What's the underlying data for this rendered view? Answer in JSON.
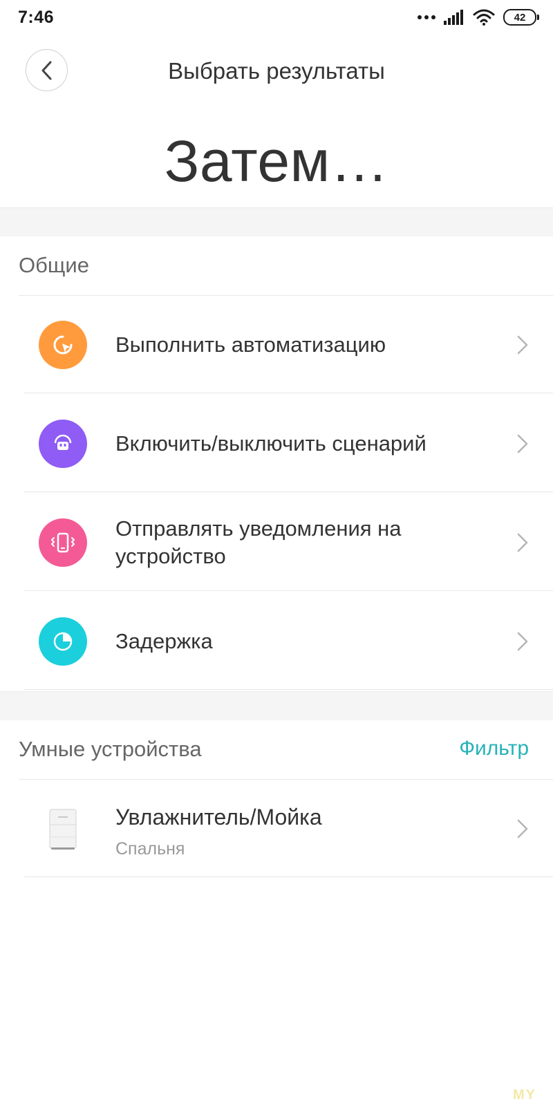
{
  "status_bar": {
    "time": "7:46",
    "battery": "42",
    "icons": [
      "more-dots-icon",
      "signal-icon",
      "wifi-icon",
      "battery-icon"
    ]
  },
  "header": {
    "title": "Выбрать результаты"
  },
  "page_title": "Затем…",
  "general_section": {
    "title": "Общие",
    "items": [
      {
        "label": "Выполнить автоматизацию",
        "icon": "automation-icon",
        "color": "#ff9b3d"
      },
      {
        "label": "Включить/выключить сценарий",
        "icon": "scenario-icon",
        "color": "#8f5cf5"
      },
      {
        "label": "Отправлять уведомления на устройство",
        "icon": "notification-icon",
        "color": "#f45b96"
      },
      {
        "label": "Задержка",
        "icon": "delay-icon",
        "color": "#1ccfdc"
      }
    ]
  },
  "devices_section": {
    "title": "Умные устройства",
    "filter_label": "Фильтр",
    "filter_color": "#27b3b8",
    "devices": [
      {
        "name": "Увлажнитель/Мойка",
        "room": "Спальня",
        "icon": "humidifier-icon"
      }
    ]
  },
  "watermark": "MY"
}
